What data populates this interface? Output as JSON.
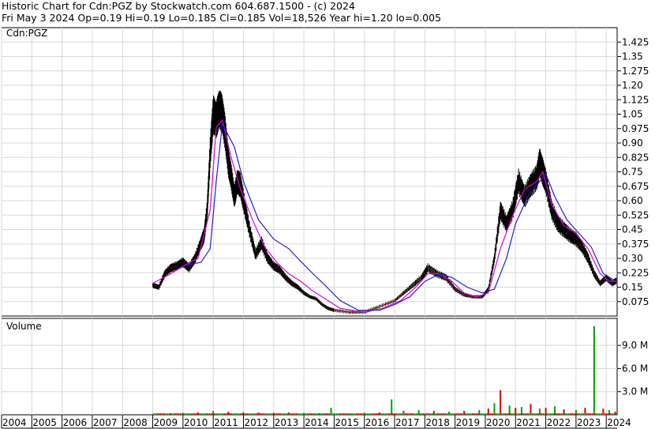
{
  "header": {
    "line1": "Historic Chart for Cdn:PGZ by Stockwatch.com 604.687.1500 - (c) 2024",
    "line2": "Fri May  3 2024   Op=0.19  Hi=0.19  Lo=0.185  Cl=0.185  Vol=18,526  Year hi=1.20  lo=0.005"
  },
  "chart_data": [
    {
      "type": "line",
      "title": "",
      "symbol_label": "Cdn:PGZ",
      "y_ticks": [
        "1.425",
        "1.35",
        "1.275",
        "1.20",
        "1.125",
        "1.05",
        "0.975",
        "0.90",
        "0.825",
        "0.75",
        "0.675",
        "0.60",
        "0.525",
        "0.45",
        "0.375",
        "0.30",
        "0.225",
        "0.15",
        "0.075"
      ],
      "ylim": [
        0,
        1.5
      ],
      "x_ticks": [
        "2004",
        "2005",
        "2006",
        "2007",
        "2008",
        "2009",
        "2010",
        "2011",
        "2012",
        "2013",
        "2014",
        "2015",
        "2016",
        "2017",
        "2018",
        "2019",
        "2020",
        "2021",
        "2022",
        "2023",
        "2024"
      ],
      "xlim": [
        2004.0,
        2024.36
      ],
      "grid": true,
      "colors": {
        "price": "#000000",
        "up": "#00a000",
        "down": "#e00000",
        "ma_short": "#e000e0",
        "ma_long": "#2020d0"
      },
      "series": [
        {
          "name": "",
          "x": [
            2009.0,
            2009.2,
            2009.4,
            2009.6,
            2009.8,
            2010.0,
            2010.2,
            2010.4,
            2010.6,
            2010.7,
            2010.8,
            2010.9,
            2011.0,
            2011.1,
            2011.2,
            2011.3,
            2011.4,
            2011.5,
            2011.6,
            2011.7,
            2011.8,
            2011.9,
            2012.0,
            2012.2,
            2012.4,
            2012.6,
            2012.8,
            2013.0,
            2013.2,
            2013.4,
            2013.6,
            2013.8,
            2014.0,
            2014.2,
            2014.4,
            2014.6,
            2014.8,
            2015.0,
            2015.5,
            2016.0,
            2016.5,
            2017.0,
            2017.3,
            2017.6,
            2017.9,
            2018.1,
            2018.4,
            2018.7,
            2019.0,
            2019.3,
            2019.6,
            2019.9,
            2020.1,
            2020.3,
            2020.5,
            2020.7,
            2020.9,
            2021.1,
            2021.3,
            2021.5,
            2021.7,
            2021.8,
            2021.9,
            2022.0,
            2022.2,
            2022.4,
            2022.6,
            2022.8,
            2023.0,
            2023.2,
            2023.4,
            2023.6,
            2023.8,
            2024.0,
            2024.2,
            2024.34
          ],
          "y": [
            0.16,
            0.15,
            0.22,
            0.25,
            0.26,
            0.28,
            0.25,
            0.3,
            0.38,
            0.42,
            0.55,
            0.85,
            1.05,
            1.02,
            1.08,
            1.05,
            0.95,
            0.8,
            0.72,
            0.62,
            0.7,
            0.68,
            0.6,
            0.45,
            0.32,
            0.38,
            0.3,
            0.26,
            0.24,
            0.2,
            0.17,
            0.15,
            0.12,
            0.1,
            0.09,
            0.06,
            0.04,
            0.03,
            0.02,
            0.02,
            0.05,
            0.08,
            0.12,
            0.16,
            0.2,
            0.25,
            0.22,
            0.2,
            0.14,
            0.11,
            0.1,
            0.1,
            0.14,
            0.3,
            0.55,
            0.48,
            0.55,
            0.7,
            0.62,
            0.68,
            0.72,
            0.8,
            0.75,
            0.7,
            0.55,
            0.48,
            0.45,
            0.42,
            0.4,
            0.36,
            0.3,
            0.22,
            0.17,
            0.2,
            0.17,
            0.185
          ]
        },
        {
          "name": "",
          "x": [
            2009.0,
            2009.6,
            2010.0,
            2010.5,
            2010.9,
            2011.1,
            2011.3,
            2011.6,
            2011.9,
            2012.3,
            2012.7,
            2013.1,
            2013.5,
            2013.9,
            2014.3,
            2014.7,
            2015.2,
            2016.0,
            2016.6,
            2017.2,
            2017.7,
            2018.1,
            2018.5,
            2018.9,
            2019.3,
            2019.7,
            2020.1,
            2020.5,
            2020.9,
            2021.3,
            2021.7,
            2021.9,
            2022.2,
            2022.6,
            2023.0,
            2023.4,
            2023.8,
            2024.1,
            2024.34
          ],
          "y": [
            0.17,
            0.22,
            0.26,
            0.3,
            0.55,
            0.98,
            1.02,
            0.82,
            0.66,
            0.5,
            0.36,
            0.28,
            0.22,
            0.18,
            0.13,
            0.09,
            0.04,
            0.02,
            0.04,
            0.08,
            0.15,
            0.22,
            0.22,
            0.18,
            0.12,
            0.1,
            0.12,
            0.35,
            0.52,
            0.66,
            0.7,
            0.75,
            0.58,
            0.47,
            0.43,
            0.35,
            0.22,
            0.18,
            0.18
          ]
        },
        {
          "name": "",
          "x": [
            2010.0,
            2010.6,
            2010.9,
            2011.1,
            2011.3,
            2011.7,
            2012.0,
            2012.5,
            2013.0,
            2013.5,
            2013.8,
            2014.3,
            2014.7,
            2015.2,
            2015.8,
            2016.5,
            2017.0,
            2017.5,
            2018.0,
            2018.5,
            2018.9,
            2019.4,
            2019.9,
            2020.3,
            2020.7,
            2021.0,
            2021.4,
            2021.8,
            2022.0,
            2022.3,
            2022.7,
            2023.1,
            2023.5,
            2023.9,
            2024.34
          ],
          "y": [
            0.26,
            0.28,
            0.35,
            0.7,
            1.0,
            0.88,
            0.7,
            0.5,
            0.4,
            0.35,
            0.3,
            0.22,
            0.16,
            0.08,
            0.03,
            0.03,
            0.06,
            0.1,
            0.18,
            0.22,
            0.2,
            0.15,
            0.12,
            0.14,
            0.3,
            0.48,
            0.62,
            0.7,
            0.74,
            0.62,
            0.5,
            0.43,
            0.36,
            0.22,
            0.18
          ]
        }
      ]
    },
    {
      "type": "bar",
      "title": "Volume",
      "y_ticks": [
        "9.0 M",
        "6.0 M",
        "3.0 M"
      ],
      "ylim": [
        0,
        12.5
      ],
      "x": [
        2009.2,
        2009.6,
        2010.0,
        2010.5,
        2011.0,
        2011.5,
        2012.0,
        2012.5,
        2013.0,
        2013.5,
        2014.0,
        2014.5,
        2014.9,
        2015.5,
        2016.0,
        2016.5,
        2016.9,
        2017.3,
        2017.8,
        2018.3,
        2018.8,
        2019.3,
        2019.8,
        2020.1,
        2020.3,
        2020.5,
        2020.8,
        2021.0,
        2021.2,
        2021.5,
        2021.8,
        2022.0,
        2022.3,
        2022.6,
        2023.0,
        2023.3,
        2023.6,
        2023.9,
        2024.1,
        2024.3
      ],
      "values": [
        0.15,
        0.2,
        0.25,
        0.3,
        0.5,
        0.4,
        0.35,
        0.3,
        0.25,
        0.3,
        0.25,
        0.2,
        0.9,
        0.2,
        0.25,
        0.3,
        2.0,
        0.5,
        0.6,
        0.5,
        0.4,
        0.5,
        0.6,
        0.8,
        1.5,
        3.2,
        1.2,
        0.9,
        1.0,
        1.4,
        0.8,
        0.9,
        1.1,
        0.7,
        0.6,
        0.9,
        11.5,
        0.8,
        0.6,
        0.4
      ]
    }
  ]
}
